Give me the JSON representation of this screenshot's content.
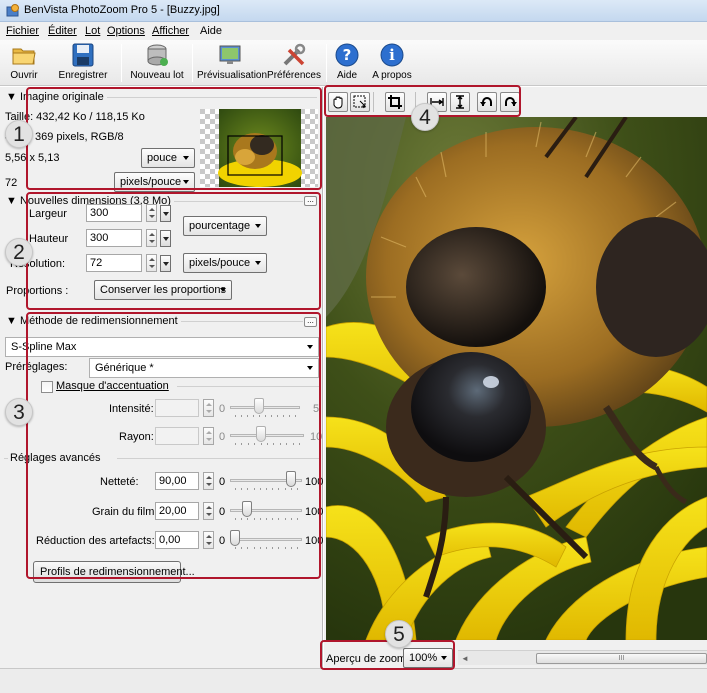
{
  "window": {
    "title": "BenVista PhotoZoom Pro 5 - [Buzzy.jpg]"
  },
  "menu": [
    "Fichier",
    "Éditer",
    "Lot",
    "Options",
    "Afficher",
    "Aide"
  ],
  "toolbar": {
    "open": "Ouvrir",
    "save": "Enregistrer",
    "new_batch": "Nouveau lot",
    "preview": "Prévisualisation",
    "preferences": "Préférences",
    "help": "Aide",
    "about": "A propos"
  },
  "original": {
    "title": "Imagine originale",
    "size": "Taille: 432,42 Ko / 118,15 Ko",
    "pixels": "400 x 369 pixels, RGB/8",
    "dims": "5,56 x 5,13",
    "unit": "pouce",
    "resolution": "72",
    "res_unit": "pixels/pouce"
  },
  "new_dims": {
    "title": "Nouvelles dimensions (3,8 Mo)",
    "width_label": "Largeur",
    "width": "300",
    "height_label": "Hauteur",
    "height": "300",
    "size_unit": "pourcentage",
    "res_label": "Résolution:",
    "resolution": "72",
    "res_unit": "pixels/pouce",
    "prop_label": "Proportions :",
    "proportions": "Conserver les proportions"
  },
  "method": {
    "title": "Méthode de redimensionnement",
    "algorithm": "S-Spline Max",
    "presets_label": "Préréglages:",
    "preset": "Générique *",
    "mask_label": "Masque d'accentuation",
    "intensity_label": "Intensité:",
    "intensity_min": "0",
    "intensity_max": "5",
    "radius_label": "Rayon:",
    "radius_min": "0",
    "radius_max": "10",
    "advanced_label": "Réglages avancés",
    "sharpness_label": "Netteté:",
    "sharpness": "90,00",
    "grain_label": "Grain du film:",
    "grain": "20,00",
    "artifacts_label": "Réduction des artefacts:",
    "artifacts": "0,00",
    "range_min": "0",
    "range_max": "100",
    "profiles_button": "Profils de redimensionnement..."
  },
  "sliders": {
    "sharpness": 0.9,
    "grain": 0.2,
    "artifacts": 0.0,
    "intensity": 0.4,
    "radius": 0.4
  },
  "zoom": {
    "label": "Aperçu de zoom :",
    "value": "100%"
  },
  "scrollbar": {
    "grip": "III"
  },
  "callouts": [
    "1",
    "2",
    "3",
    "4",
    "5"
  ],
  "icons": {
    "viewer_tools": [
      "hand-icon",
      "zoom-select-icon",
      "crop-icon",
      "fit-width-icon",
      "fit-height-icon",
      "rotate-left-icon",
      "rotate-right-icon"
    ]
  },
  "colors": {
    "callout": "#b0162c",
    "bee_yellow": "#f2d600",
    "bee_dark": "#2a2320"
  }
}
